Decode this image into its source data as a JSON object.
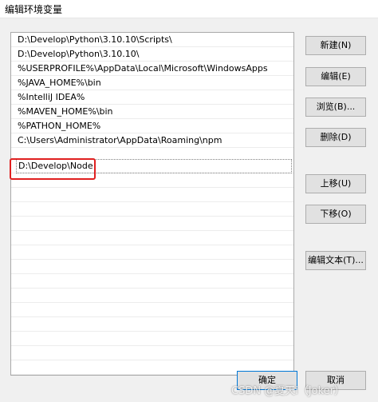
{
  "window": {
    "title": "编辑环境变量"
  },
  "list": {
    "items": [
      "D:\\Develop\\Python\\3.10.10\\Scripts\\",
      "D:\\Develop\\Python\\3.10.10\\",
      "%USERPROFILE%\\AppData\\Local\\Microsoft\\WindowsApps",
      "%JAVA_HOME%\\bin",
      "%IntelliJ IDEA%",
      "%MAVEN_HOME%\\bin",
      "%PATHON_HOME%",
      "C:\\Users\\Administrator\\AppData\\Roaming\\npm"
    ],
    "editing_value": "D:\\Develop\\Node"
  },
  "buttons": {
    "new": "新建(N)",
    "edit": "编辑(E)",
    "browse": "浏览(B)...",
    "delete": "删除(D)",
    "move_up": "上移(U)",
    "move_down": "下移(O)",
    "edit_text": "编辑文本(T)...",
    "ok": "确定",
    "cancel": "取消"
  },
  "watermark": "CSDN @夏天i（Joker）",
  "colors": {
    "highlight_border": "#e02020",
    "ok_border": "#0078d7"
  }
}
